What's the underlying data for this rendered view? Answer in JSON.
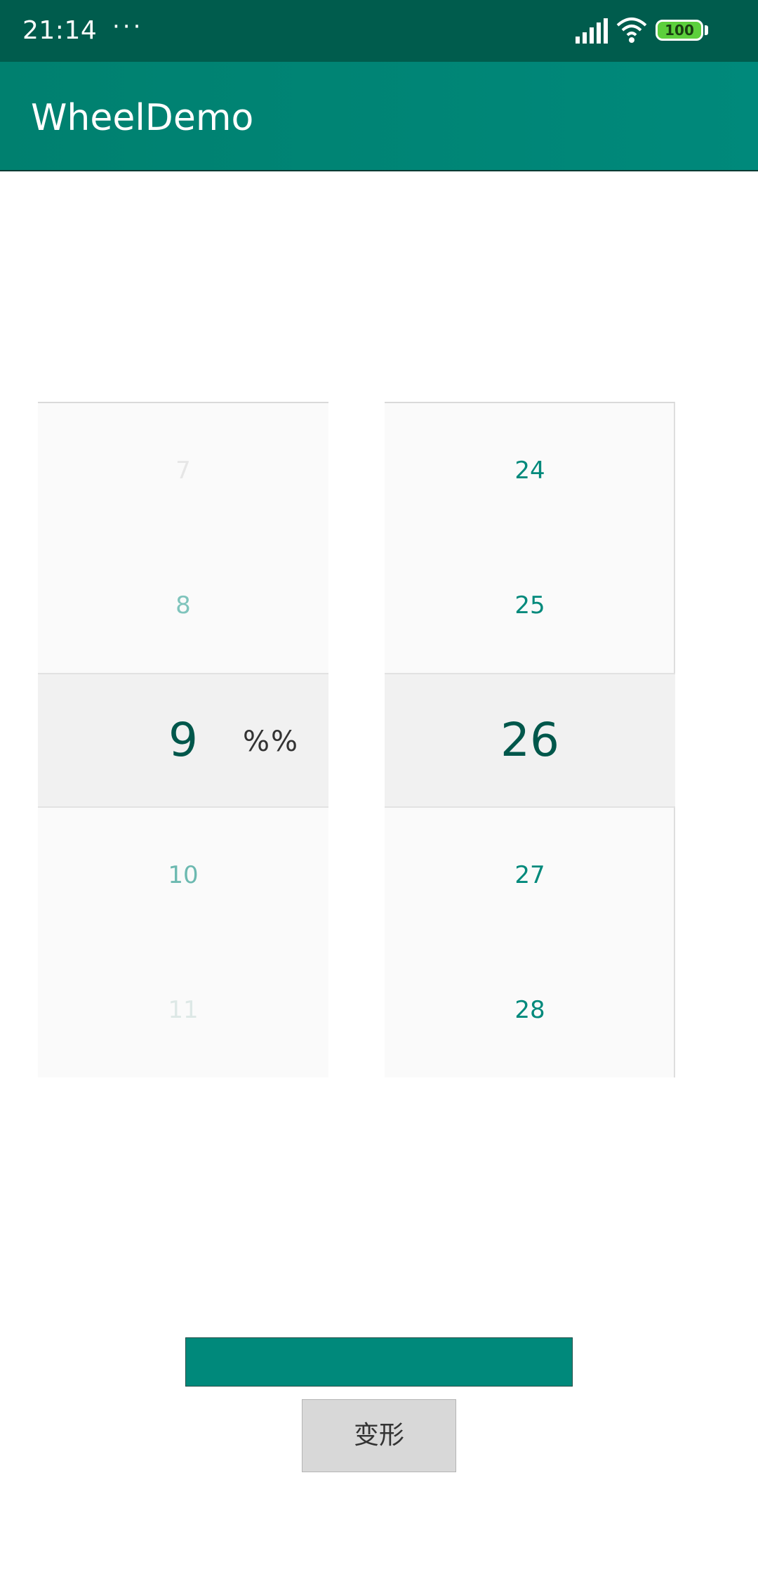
{
  "status_bar": {
    "time": "21:14",
    "dots": "···",
    "battery": "100"
  },
  "app_bar": {
    "title": "WheelDemo"
  },
  "wheel_left": {
    "items": [
      "7",
      "8",
      "9",
      "10",
      "11"
    ],
    "selected": "9",
    "unit_label": "%%"
  },
  "wheel_right": {
    "items": [
      "24",
      "25",
      "26",
      "27",
      "28"
    ],
    "selected": "26"
  },
  "button": {
    "label": "变形"
  },
  "colors": {
    "status_bar": "#005c4d",
    "app_bar": "#00897b",
    "selected_text": "#00574b",
    "accent": "#00897b",
    "button_bg": "#d8d8d8"
  }
}
